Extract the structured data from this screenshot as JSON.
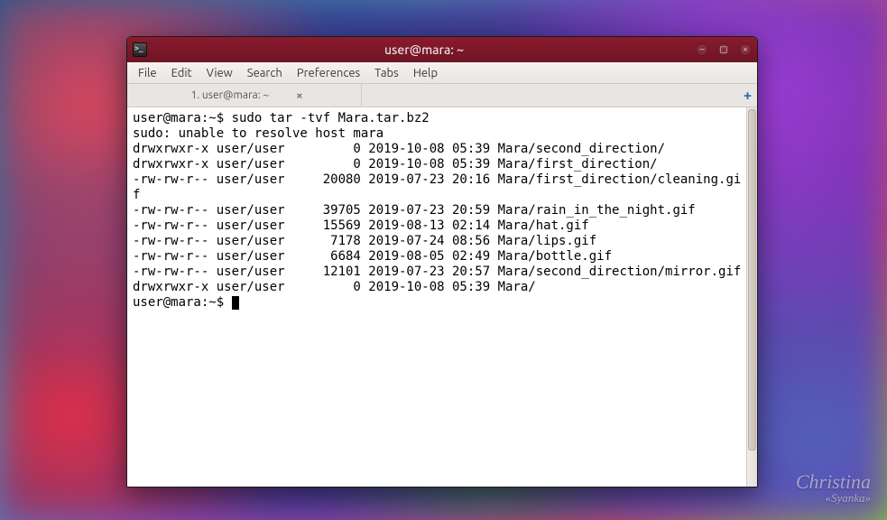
{
  "window": {
    "title": "user@mara: ~"
  },
  "menubar": {
    "items": [
      "File",
      "Edit",
      "View",
      "Search",
      "Preferences",
      "Tabs",
      "Help"
    ]
  },
  "tabbar": {
    "tabs": [
      {
        "label": "1. user@mara: ~"
      }
    ],
    "add_label": "+"
  },
  "terminal": {
    "prompt1_user": "user@mara",
    "prompt1_path": ":~$ ",
    "command1": "sudo tar -tvf Mara.tar.bz2",
    "lines": [
      "sudo: unable to resolve host mara",
      "drwxrwxr-x user/user         0 2019-10-08 05:39 Mara/second_direction/",
      "drwxrwxr-x user/user         0 2019-10-08 05:39 Mara/first_direction/",
      "-rw-rw-r-- user/user     20080 2019-07-23 20:16 Mara/first_direction/cleaning.gi",
      "f",
      "-rw-rw-r-- user/user     39705 2019-07-23 20:59 Mara/rain_in_the_night.gif",
      "-rw-rw-r-- user/user     15569 2019-08-13 02:14 Mara/hat.gif",
      "-rw-rw-r-- user/user      7178 2019-07-24 08:56 Mara/lips.gif",
      "-rw-rw-r-- user/user      6684 2019-08-05 02:49 Mara/bottle.gif",
      "-rw-rw-r-- user/user     12101 2019-07-23 20:57 Mara/second_direction/mirror.gif",
      "drwxrwxr-x user/user         0 2019-10-08 05:39 Mara/"
    ],
    "prompt2_user": "user@mara",
    "prompt2_path": ":~$ "
  },
  "watermark": {
    "line1": "Christina",
    "line2": "«Syanka»"
  }
}
